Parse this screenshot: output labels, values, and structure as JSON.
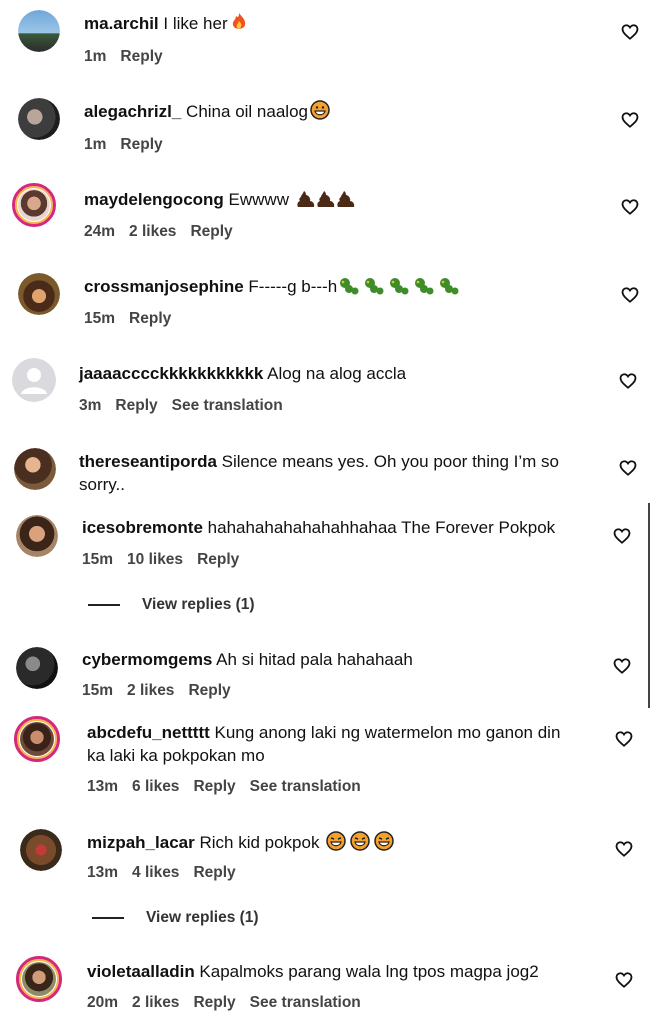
{
  "comments": [
    {
      "user": "ma.archil",
      "text": " I like her",
      "likes": "",
      "time": "1m",
      "reply": "Reply",
      "translate": "",
      "emoji": "fire"
    },
    {
      "user": "alegachrizl_",
      "text": " China oil naalog",
      "likes": "",
      "time": "1m",
      "reply": "Reply",
      "translate": "",
      "emoji": "grin"
    },
    {
      "user": "maydelengocong",
      "text": " Ewwww",
      "likes": "2 likes",
      "time": "24m",
      "reply": "Reply",
      "translate": "",
      "emoji": "poop3"
    },
    {
      "user": "crossmanjosephine",
      "text": " F-----g b---h",
      "likes": "",
      "time": "15m",
      "reply": "Reply",
      "translate": "",
      "emoji": "cater5"
    },
    {
      "user": "jaaaacccckkkkkkkkkkk",
      "text": " Alog na alog accla",
      "likes": "",
      "time": "3m",
      "reply": "Reply",
      "translate": "See translation",
      "emoji": ""
    },
    {
      "user": "thereseantiporda",
      "text": " Silence means yes. Oh you poor thing I’m so",
      "text2": "sorry..",
      "likes": "",
      "time": "",
      "reply": "",
      "translate": "",
      "emoji": ""
    },
    {
      "user": "icesobremonte",
      "text": " hahahahahahahahhahaa The Forever Pokpok",
      "likes": "10 likes",
      "time": "15m",
      "reply": "Reply",
      "translate": "",
      "emoji": ""
    },
    {
      "user": "cybermomgems",
      "text": " Ah si hitad pala hahahaah",
      "likes": "2 likes",
      "time": "15m",
      "reply": "Reply",
      "translate": "",
      "emoji": ""
    },
    {
      "user": "abcdefu_nettttt",
      "text": " Kung anong laki ng watermelon mo ganon din",
      "text2": "ka laki ka pokpokan mo",
      "likes": "6 likes",
      "time": "13m",
      "reply": "Reply",
      "translate": "See translation",
      "emoji": ""
    },
    {
      "user": "mizpah_lacar",
      "text": " Rich kid pokpok",
      "likes": "4 likes",
      "time": "13m",
      "reply": "Reply",
      "translate": "",
      "emoji": "laugh3"
    },
    {
      "user": "violetaalladin",
      "text": " Kapalmoks parang wala lng tpos magpa jog2",
      "likes": "2 likes",
      "time": "20m",
      "reply": "Reply",
      "translate": "See translation",
      "emoji": ""
    }
  ],
  "view_replies": [
    "View replies (1)",
    "View replies (1)"
  ]
}
